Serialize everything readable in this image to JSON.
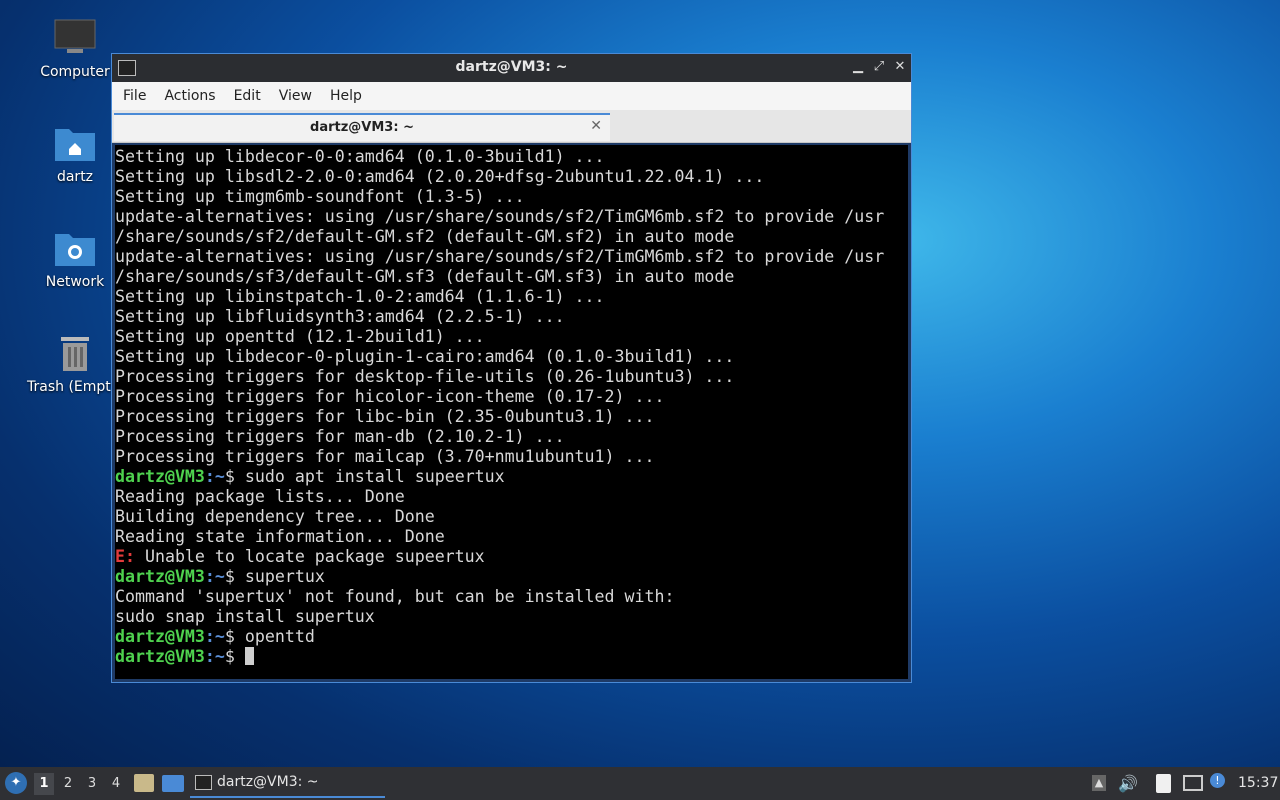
{
  "desktop": {
    "icons": [
      {
        "label": "Computer"
      },
      {
        "label": "dartz"
      },
      {
        "label": "Network"
      },
      {
        "label": "Trash (Empty)"
      }
    ]
  },
  "window": {
    "title": "dartz@VM3: ~",
    "menu": [
      "File",
      "Actions",
      "Edit",
      "View",
      "Help"
    ],
    "tab_label": "dartz@VM3: ~"
  },
  "terminal": {
    "prompt_user": "dartz@VM3",
    "prompt_path": "~",
    "lines": [
      "Setting up libdecor-0-0:amd64 (0.1.0-3build1) ...",
      "Setting up libsdl2-2.0-0:amd64 (2.0.20+dfsg-2ubuntu1.22.04.1) ...",
      "Setting up timgm6mb-soundfont (1.3-5) ...",
      "update-alternatives: using /usr/share/sounds/sf2/TimGM6mb.sf2 to provide /usr",
      "/share/sounds/sf2/default-GM.sf2 (default-GM.sf2) in auto mode",
      "update-alternatives: using /usr/share/sounds/sf2/TimGM6mb.sf2 to provide /usr",
      "/share/sounds/sf3/default-GM.sf3 (default-GM.sf3) in auto mode",
      "Setting up libinstpatch-1.0-2:amd64 (1.1.6-1) ...",
      "Setting up libfluidsynth3:amd64 (2.2.5-1) ...",
      "Setting up openttd (12.1-2build1) ...",
      "Setting up libdecor-0-plugin-1-cairo:amd64 (0.1.0-3build1) ...",
      "Processing triggers for desktop-file-utils (0.26-1ubuntu3) ...",
      "Processing triggers for hicolor-icon-theme (0.17-2) ...",
      "Processing triggers for libc-bin (2.35-0ubuntu3.1) ...",
      "Processing triggers for man-db (2.10.2-1) ...",
      "Processing triggers for mailcap (3.70+nmu1ubuntu1) ..."
    ],
    "cmd1": "$ sudo apt install supeertux",
    "out1": [
      "Reading package lists... Done",
      "Building dependency tree... Done",
      "Reading state information... Done"
    ],
    "err_prefix": "E:",
    "err_text": " Unable to locate package supeertux",
    "cmd2": "$ supertux",
    "out2": [
      "Command 'supertux' not found, but can be installed with:",
      "sudo snap install supertux"
    ],
    "cmd3": "$ openttd",
    "cmd4": "$ "
  },
  "taskbar": {
    "workspaces": [
      "1",
      "2",
      "3",
      "4"
    ],
    "active_workspace": "1",
    "task_label": "dartz@VM3: ~",
    "clock": "15:37"
  }
}
